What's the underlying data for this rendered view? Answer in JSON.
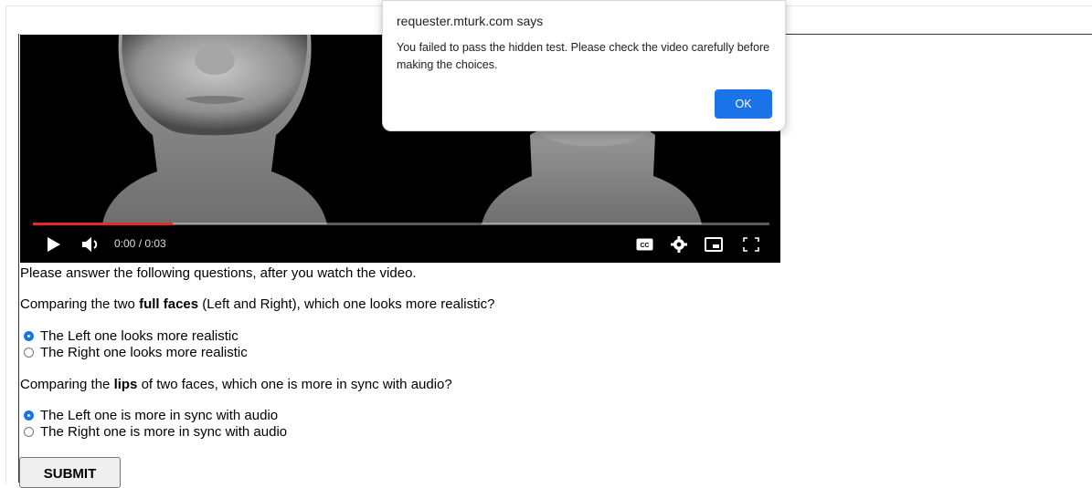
{
  "dialog": {
    "title": "requester.mturk.com says",
    "message": "You failed to pass the hidden test. Please check the video carefully before making the choices.",
    "ok_label": "OK"
  },
  "video": {
    "time_display": "0:00 / 0:03",
    "progress_fraction": 0.19,
    "icons": [
      "play-icon",
      "volume-icon",
      "captions-icon",
      "settings-icon",
      "miniplayer-icon",
      "fullscreen-icon"
    ]
  },
  "survey": {
    "instruction": "Please answer the following questions, after you watch the video.",
    "q1": {
      "prefix": "Comparing the two ",
      "bold": "full faces",
      "suffix": " (Left and Right), which one looks more realistic?",
      "options": [
        "The Left one looks more realistic",
        "The Right one looks more realistic"
      ],
      "selected": 0
    },
    "q2": {
      "prefix": "Comparing the ",
      "bold": "lips",
      "suffix": " of two faces, which one is more in sync with audio?",
      "options": [
        "The Left one is more in sync with audio",
        "The Right one is more in sync with audio"
      ],
      "selected": 0
    },
    "submit_label": "SUBMIT"
  },
  "colors": {
    "accent": "#1a73e8",
    "progress": "#e52a22"
  }
}
